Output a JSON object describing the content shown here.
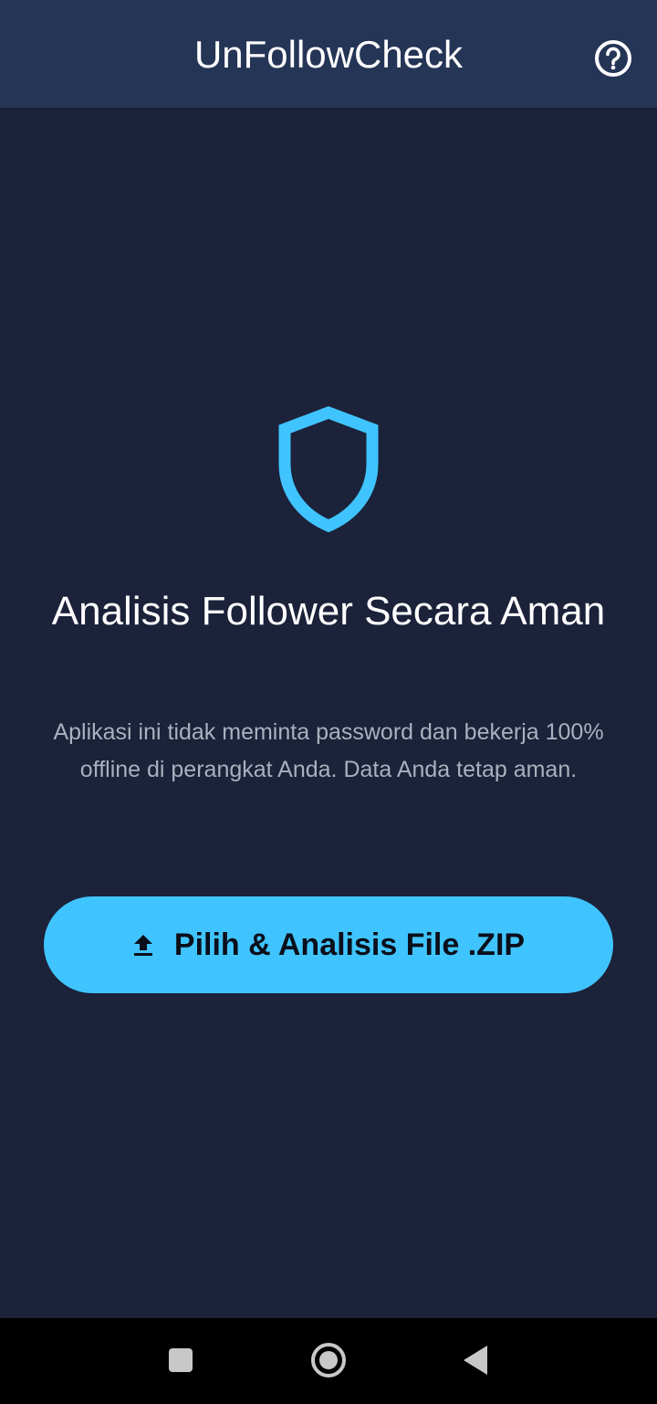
{
  "app_bar": {
    "title": "UnFollowCheck",
    "help_icon": "help-circle-icon"
  },
  "main": {
    "icon": "shield-outline-icon",
    "heading": "Analisis Follower Secara Aman",
    "description": "Aplikasi ini tidak meminta password dan bekerja 100% offline di perangkat Anda. Data Anda tetap aman.",
    "button": {
      "label": "Pilih & Analisis File .ZIP",
      "icon": "upload-icon"
    }
  },
  "navigation_bar": {
    "recents": "square-icon",
    "home": "circle-icon",
    "back": "triangle-back-icon"
  },
  "colors": {
    "app_bar": "#253556",
    "background": "#1b2239",
    "accent": "#40c4ff",
    "nav_bar": "#000000"
  }
}
